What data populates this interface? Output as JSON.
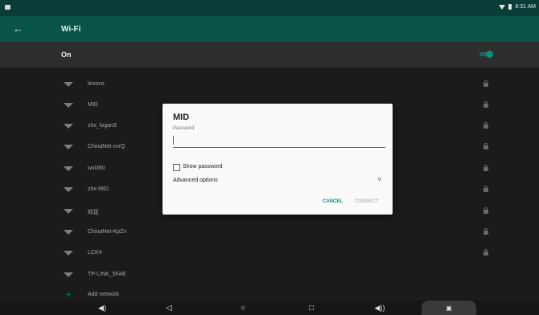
{
  "status_bar": {
    "time": "8:31 AM"
  },
  "app_bar": {
    "back_icon": "arrow-back-icon",
    "title": "Wi-Fi"
  },
  "master_switch": {
    "label": "On",
    "state": "on"
  },
  "networks": [
    {
      "name": "lenovo",
      "locked": true
    },
    {
      "name": "MID",
      "locked": true
    },
    {
      "name": "zhx_logan3",
      "locked": true
    },
    {
      "name": "ChinaNet-cvrQ",
      "locked": true
    },
    {
      "name": "wxl360",
      "locked": true
    },
    {
      "name": "zhx-MID",
      "locked": true
    },
    {
      "name": "知足",
      "locked": true
    },
    {
      "name": "ChinaNet-KpZn",
      "locked": true
    },
    {
      "name": "LCK4",
      "locked": true
    },
    {
      "name": "TP-LINK_5FAE",
      "locked": false
    }
  ],
  "add_network": {
    "label": "Add network"
  },
  "dialog": {
    "title": "MID",
    "password_label": "Password",
    "password_value": "",
    "show_password_label": "Show password",
    "advanced_options_label": "Advanced options",
    "cancel_label": "CANCEL",
    "connect_label": "CONNECT"
  },
  "colors": {
    "accent": "#0a8a75",
    "app_bar": "#0a5448",
    "status_bar": "#0a3d37",
    "background": "#1b1b1b"
  }
}
